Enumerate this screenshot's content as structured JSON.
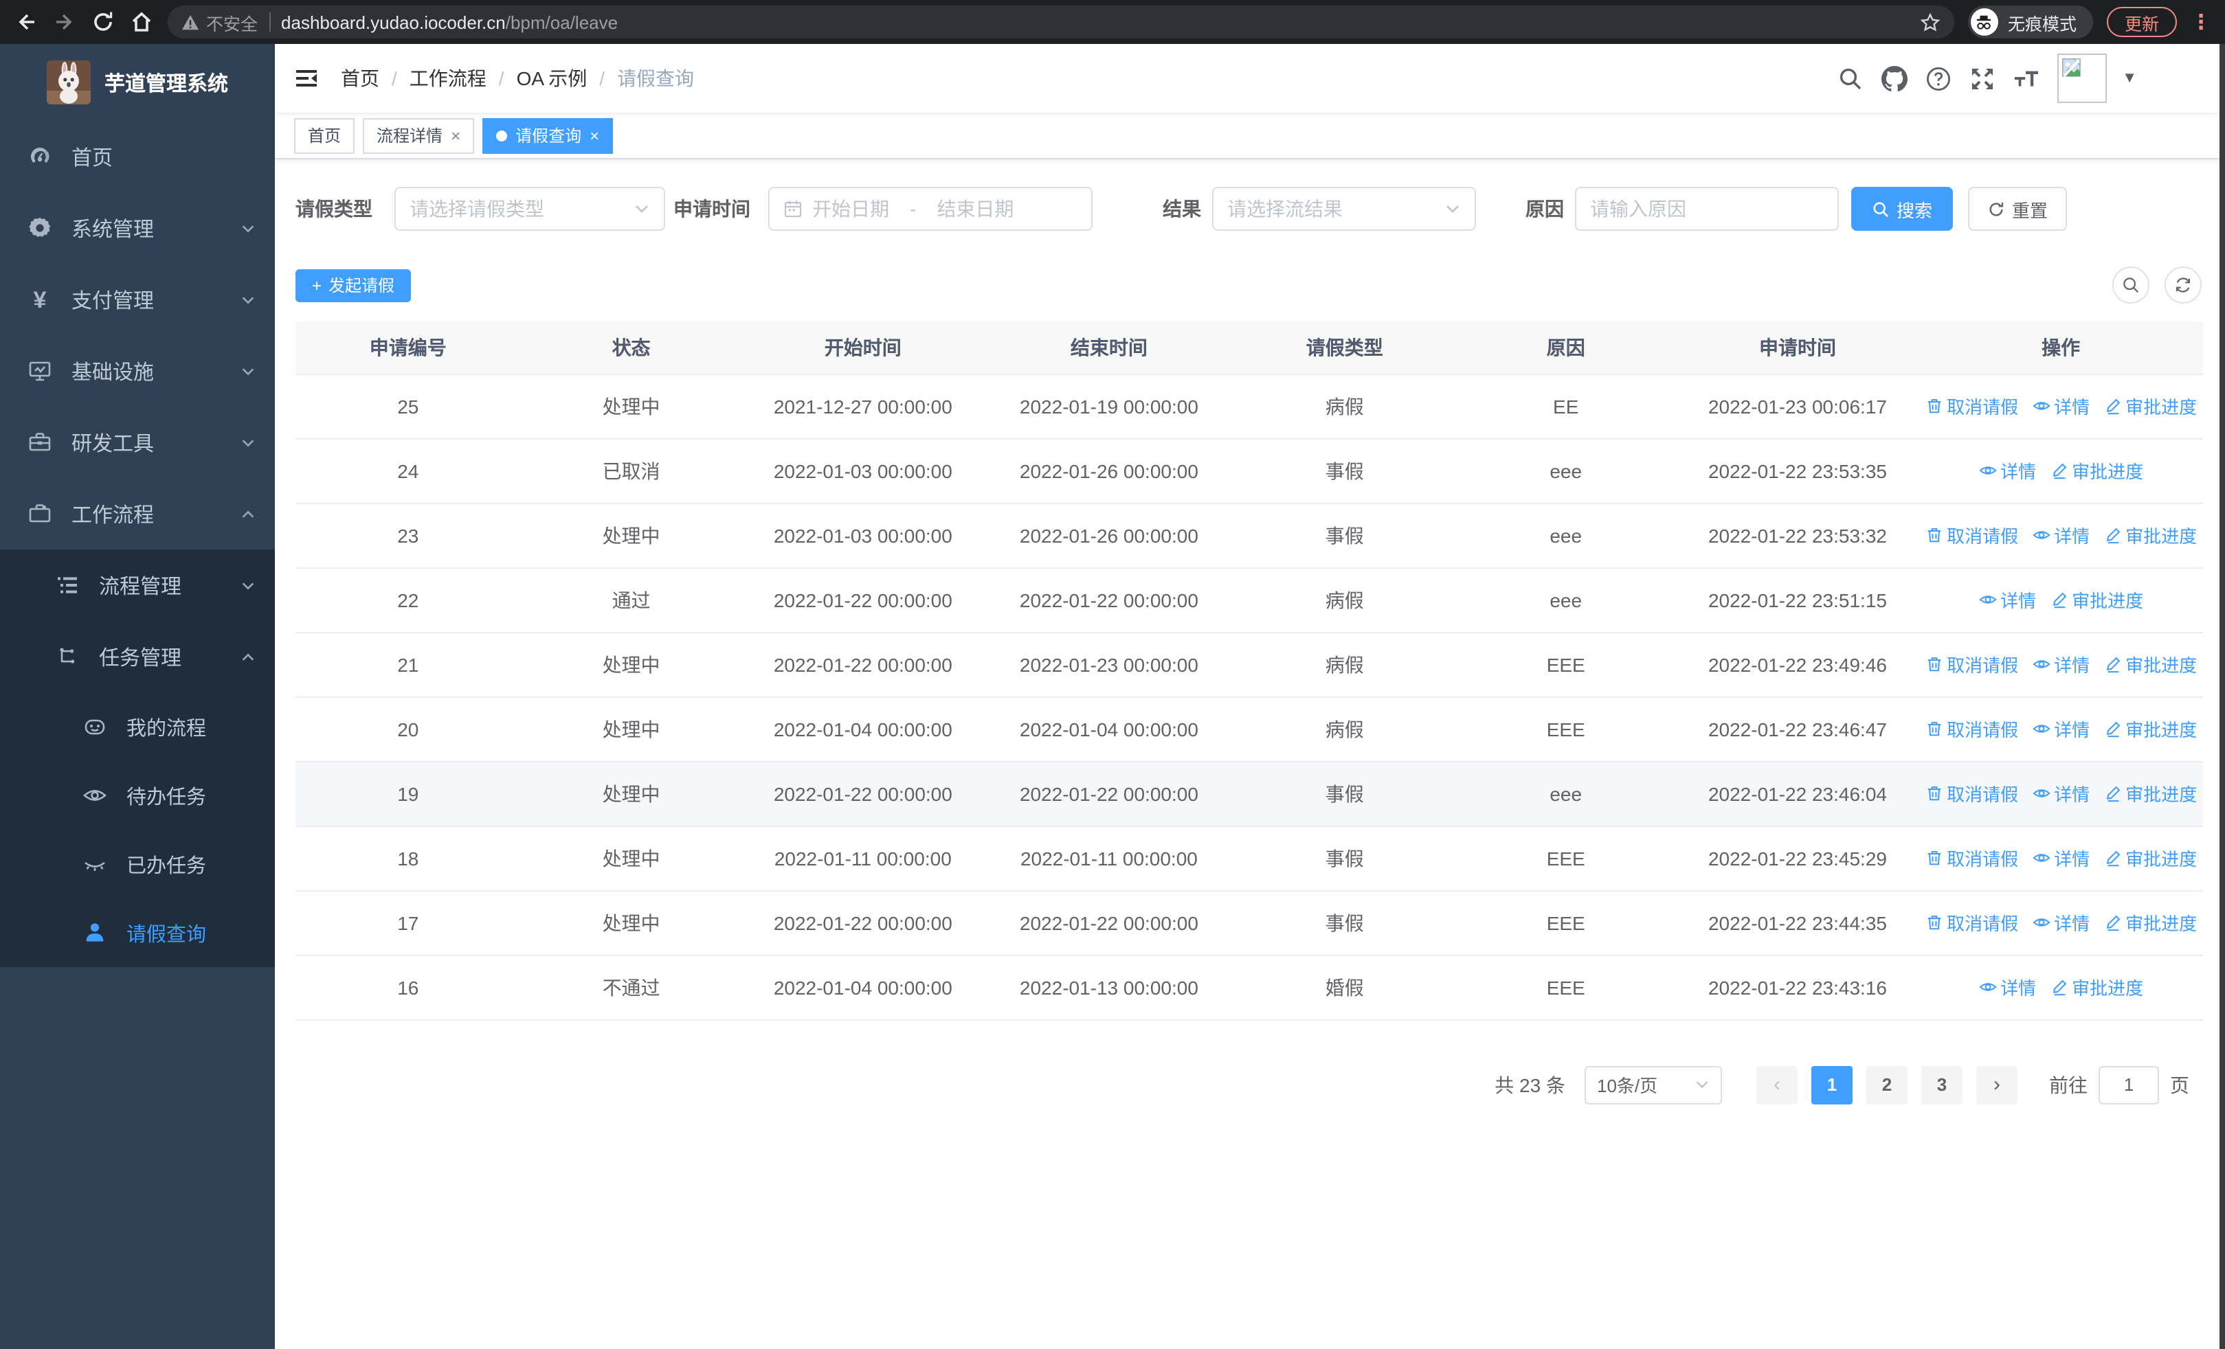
{
  "browser": {
    "security_label": "不安全",
    "url_host": "dashboard.yudao.iocoder.cn",
    "url_path": "/bpm/oa/leave",
    "incognito_label": "无痕模式",
    "update_button": "更新",
    "menu_dots": "⋮"
  },
  "sidebar": {
    "title": "芋道管理系统",
    "items": [
      {
        "label": "首页"
      },
      {
        "label": "系统管理"
      },
      {
        "label": "支付管理"
      },
      {
        "label": "基础设施"
      },
      {
        "label": "研发工具"
      },
      {
        "label": "工作流程"
      },
      {
        "label": "流程管理"
      },
      {
        "label": "任务管理"
      },
      {
        "label": "我的流程"
      },
      {
        "label": "待办任务"
      },
      {
        "label": "已办任务"
      },
      {
        "label": "请假查询"
      }
    ],
    "yen_glyph": "¥"
  },
  "breadcrumb": {
    "items": [
      "首页",
      "工作流程",
      "OA 示例",
      "请假查询"
    ],
    "separator": "/"
  },
  "tabs": [
    {
      "label": "首页",
      "closable": false,
      "active": false
    },
    {
      "label": "流程详情",
      "closable": true,
      "active": false
    },
    {
      "label": "请假查询",
      "closable": true,
      "active": true
    }
  ],
  "tab_close_glyph": "×",
  "filters": {
    "leave_type_label": "请假类型",
    "leave_type_placeholder": "请选择请假类型",
    "apply_time_label": "申请时间",
    "start_date_placeholder": "开始日期",
    "date_separator": "-",
    "end_date_placeholder": "结束日期",
    "result_label": "结果",
    "result_placeholder": "请选择流结果",
    "reason_label": "原因",
    "reason_placeholder": "请输入原因",
    "search_button": "搜索",
    "reset_button": "重置"
  },
  "toolbar": {
    "create_button": "发起请假",
    "create_plus": "+"
  },
  "table": {
    "columns": [
      "申请编号",
      "状态",
      "开始时间",
      "结束时间",
      "请假类型",
      "原因",
      "申请时间",
      "操作"
    ],
    "action_labels": {
      "cancel": "取消请假",
      "detail": "详情",
      "progress": "审批进度"
    },
    "rows": [
      {
        "id": "25",
        "status": "处理中",
        "start": "2021-12-27 00:00:00",
        "end": "2022-01-19 00:00:00",
        "type": "病假",
        "reason": "EE",
        "apply_time": "2022-01-23 00:06:17",
        "actions": [
          "cancel",
          "detail",
          "progress"
        ],
        "highlight": false
      },
      {
        "id": "24",
        "status": "已取消",
        "start": "2022-01-03 00:00:00",
        "end": "2022-01-26 00:00:00",
        "type": "事假",
        "reason": "eee",
        "apply_time": "2022-01-22 23:53:35",
        "actions": [
          "detail",
          "progress"
        ],
        "highlight": false
      },
      {
        "id": "23",
        "status": "处理中",
        "start": "2022-01-03 00:00:00",
        "end": "2022-01-26 00:00:00",
        "type": "事假",
        "reason": "eee",
        "apply_time": "2022-01-22 23:53:32",
        "actions": [
          "cancel",
          "detail",
          "progress"
        ],
        "highlight": false
      },
      {
        "id": "22",
        "status": "通过",
        "start": "2022-01-22 00:00:00",
        "end": "2022-01-22 00:00:00",
        "type": "病假",
        "reason": "eee",
        "apply_time": "2022-01-22 23:51:15",
        "actions": [
          "detail",
          "progress"
        ],
        "highlight": false
      },
      {
        "id": "21",
        "status": "处理中",
        "start": "2022-01-22 00:00:00",
        "end": "2022-01-23 00:00:00",
        "type": "病假",
        "reason": "EEE",
        "apply_time": "2022-01-22 23:49:46",
        "actions": [
          "cancel",
          "detail",
          "progress"
        ],
        "highlight": false
      },
      {
        "id": "20",
        "status": "处理中",
        "start": "2022-01-04 00:00:00",
        "end": "2022-01-04 00:00:00",
        "type": "病假",
        "reason": "EEE",
        "apply_time": "2022-01-22 23:46:47",
        "actions": [
          "cancel",
          "detail",
          "progress"
        ],
        "highlight": false
      },
      {
        "id": "19",
        "status": "处理中",
        "start": "2022-01-22 00:00:00",
        "end": "2022-01-22 00:00:00",
        "type": "事假",
        "reason": "eee",
        "apply_time": "2022-01-22 23:46:04",
        "actions": [
          "cancel",
          "detail",
          "progress"
        ],
        "highlight": true
      },
      {
        "id": "18",
        "status": "处理中",
        "start": "2022-01-11 00:00:00",
        "end": "2022-01-11 00:00:00",
        "type": "事假",
        "reason": "EEE",
        "apply_time": "2022-01-22 23:45:29",
        "actions": [
          "cancel",
          "detail",
          "progress"
        ],
        "highlight": false
      },
      {
        "id": "17",
        "status": "处理中",
        "start": "2022-01-22 00:00:00",
        "end": "2022-01-22 00:00:00",
        "type": "事假",
        "reason": "EEE",
        "apply_time": "2022-01-22 23:44:35",
        "actions": [
          "cancel",
          "detail",
          "progress"
        ],
        "highlight": false
      },
      {
        "id": "16",
        "status": "不通过",
        "start": "2022-01-04 00:00:00",
        "end": "2022-01-13 00:00:00",
        "type": "婚假",
        "reason": "EEE",
        "apply_time": "2022-01-22 23:43:16",
        "actions": [
          "detail",
          "progress"
        ],
        "highlight": false
      }
    ]
  },
  "pagination": {
    "total": "共 23 条",
    "page_size": "10条/页",
    "prev_glyph": "‹",
    "next_glyph": "›",
    "pages": [
      "1",
      "2",
      "3"
    ],
    "active_page": "1",
    "goto_label": "前往",
    "goto_value": "1",
    "goto_suffix": "页"
  },
  "accent_color": "#409eff"
}
